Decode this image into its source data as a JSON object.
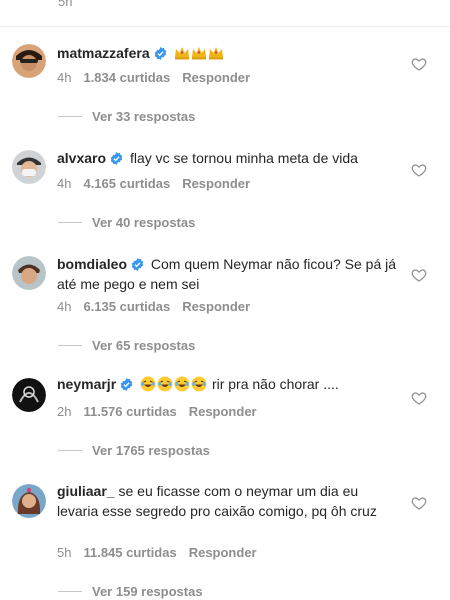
{
  "top": {
    "time": "5h"
  },
  "comments": [
    {
      "username": "matmazzafera",
      "text": "",
      "emojis": [
        "crown-icon",
        "crown-icon",
        "crown-icon"
      ],
      "time": "4h",
      "likes": "1.834 curtidas",
      "reply": "Responder",
      "view_replies": "Ver 33 respostas"
    },
    {
      "username": "alvxaro",
      "text": "flay vc se tornou minha meta de vida",
      "time": "4h",
      "likes": "4.165 curtidas",
      "reply": "Responder",
      "view_replies": "Ver 40 respostas"
    },
    {
      "username": "bomdialeo",
      "text": "Com quem Neymar não ficou? Se pá já até me pego e nem sei",
      "time": "4h",
      "likes": "6.135 curtidas",
      "reply": "Responder",
      "view_replies": "Ver 65 respostas"
    },
    {
      "username": "neymarjr",
      "text": "rir pra não chorar ....",
      "emojis": [
        "laughing-emoji",
        "laughing-emoji",
        "laughing-emoji",
        "laughing-emoji"
      ],
      "time": "2h",
      "likes": "11.576 curtidas",
      "reply": "Responder",
      "view_replies": "Ver 1765 respostas"
    },
    {
      "username": "giuliaar_",
      "text": "se eu ficasse com o neymar um dia eu levaria esse segredo pro caixão comigo, pq ôh cruz",
      "time": "5h",
      "likes": "11.845 curtidas",
      "reply": "Responder",
      "view_replies": "Ver 159 respostas"
    }
  ],
  "colors": {
    "text": "#262626",
    "meta": "#8e8e8e",
    "verified": "#3897f0",
    "crown": "#f2b41b",
    "emoji": "#ffcc33"
  }
}
